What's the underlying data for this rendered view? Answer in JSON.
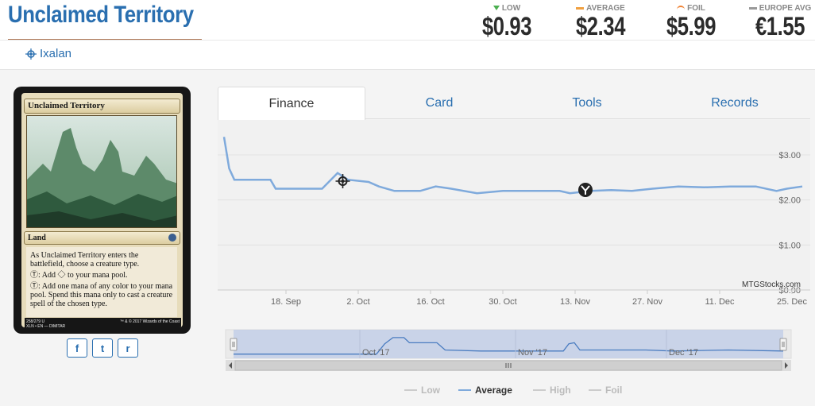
{
  "card": {
    "title": "Unclaimed Territory",
    "set_name": "Ixalan",
    "name_line": "Unclaimed Territory",
    "type_line": "Land",
    "rules": [
      "As Unclaimed Territory enters the battlefield, choose a creature type.",
      "Ⓣ: Add ◇ to your mana pool.",
      "Ⓣ: Add one mana of any color to your mana pool. Spend this mana only to cast a creature spell of the chosen type."
    ],
    "footer_left": "258/279 U\nXLN • EN — DIMITAR",
    "footer_right": "™ & © 2017 Wizards of the Coast"
  },
  "prices": {
    "low": {
      "label": "LOW",
      "value": "$0.93"
    },
    "average": {
      "label": "AVERAGE",
      "value": "$2.34"
    },
    "foil": {
      "label": "FOIL",
      "value": "$5.99"
    },
    "europe": {
      "label": "EUROPE AVG",
      "value": "€1.55"
    }
  },
  "share": {
    "facebook": "f",
    "twitter": "t",
    "reddit": "r"
  },
  "tabs": [
    {
      "label": "Finance",
      "active": true
    },
    {
      "label": "Card",
      "active": false
    },
    {
      "label": "Tools",
      "active": false
    },
    {
      "label": "Records",
      "active": false
    }
  ],
  "colors": {
    "accent": "#2a6fb0",
    "average_line": "#7faadc",
    "navigator_fill": "#c3cfe8"
  },
  "icons": {
    "set": "ixalan-compass-icon",
    "event1": "ixalan-compass-icon",
    "event2": "rivals-of-ixalan-icon"
  },
  "chart_data": {
    "type": "line",
    "credit": "MTGStocks.com",
    "x_ticks": [
      "18. Sep",
      "2. Oct",
      "16. Oct",
      "30. Oct",
      "13. Nov",
      "27. Nov",
      "11. Dec",
      "25. Dec"
    ],
    "y_ticks": [
      "$0.00",
      "$1.00",
      "$2.00",
      "$3.00"
    ],
    "ylim": [
      0,
      3.6
    ],
    "xlim": [
      "2017-09-06",
      "2017-12-27"
    ],
    "series": [
      {
        "name": "Average",
        "points": [
          [
            "2017-09-06",
            3.4
          ],
          [
            "2017-09-07",
            2.7
          ],
          [
            "2017-09-08",
            2.45
          ],
          [
            "2017-09-15",
            2.45
          ],
          [
            "2017-09-16",
            2.25
          ],
          [
            "2017-09-25",
            2.25
          ],
          [
            "2017-09-28",
            2.6
          ],
          [
            "2017-09-30",
            2.45
          ],
          [
            "2017-10-04",
            2.4
          ],
          [
            "2017-10-06",
            2.3
          ],
          [
            "2017-10-09",
            2.2
          ],
          [
            "2017-10-14",
            2.2
          ],
          [
            "2017-10-17",
            2.3
          ],
          [
            "2017-10-20",
            2.25
          ],
          [
            "2017-10-25",
            2.15
          ],
          [
            "2017-10-30",
            2.2
          ],
          [
            "2017-11-04",
            2.2
          ],
          [
            "2017-11-10",
            2.2
          ],
          [
            "2017-11-12",
            2.15
          ],
          [
            "2017-11-16",
            2.2
          ],
          [
            "2017-11-20",
            2.22
          ],
          [
            "2017-11-24",
            2.2
          ],
          [
            "2017-11-28",
            2.25
          ],
          [
            "2017-12-03",
            2.3
          ],
          [
            "2017-12-08",
            2.28
          ],
          [
            "2017-12-13",
            2.3
          ],
          [
            "2017-12-18",
            2.3
          ],
          [
            "2017-12-22",
            2.2
          ],
          [
            "2017-12-24",
            2.25
          ],
          [
            "2017-12-27",
            2.3
          ]
        ]
      }
    ],
    "navigator": {
      "labels": [
        "Oct '17",
        "Nov '17",
        "Dec '17"
      ],
      "profile": [
        [
          0.0,
          0.05
        ],
        [
          0.26,
          0.05
        ],
        [
          0.275,
          0.55
        ],
        [
          0.29,
          0.85
        ],
        [
          0.31,
          0.85
        ],
        [
          0.32,
          0.6
        ],
        [
          0.37,
          0.6
        ],
        [
          0.385,
          0.25
        ],
        [
          0.45,
          0.2
        ],
        [
          0.6,
          0.2
        ],
        [
          0.61,
          0.55
        ],
        [
          0.62,
          0.6
        ],
        [
          0.63,
          0.25
        ],
        [
          0.75,
          0.25
        ],
        [
          0.8,
          0.2
        ],
        [
          0.9,
          0.25
        ],
        [
          1.0,
          0.2
        ]
      ]
    },
    "legend": [
      "Low",
      "Average",
      "High",
      "Foil"
    ],
    "legend_active": "Average",
    "legend_position": "bottom-center"
  }
}
